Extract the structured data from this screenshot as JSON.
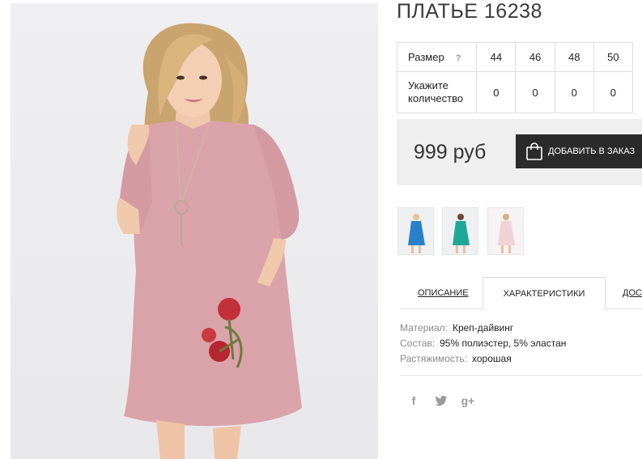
{
  "product": {
    "title": "ПЛАТЬЕ 16238",
    "main_image_alt": "pink dress model photo"
  },
  "sizes": {
    "size_label": "Размер",
    "help_label": "?",
    "qty_label_line1": "Укажите",
    "qty_label_line2": "количество",
    "values": [
      "44",
      "46",
      "48",
      "50"
    ],
    "quantities": [
      "0",
      "0",
      "0",
      "0"
    ]
  },
  "purchase": {
    "price": "999 руб",
    "add_to_cart_label": "ДОБАВИТЬ В ЗАКАЗ",
    "bag_icon": "shopping-bag-icon"
  },
  "thumbnails": [
    {
      "color": "#2a7fc9",
      "name": "blue"
    },
    {
      "color": "#1fa898",
      "name": "teal"
    },
    {
      "color": "#f0d2d6",
      "name": "pink"
    }
  ],
  "tabs": [
    {
      "label": "ОПИСАНИЕ"
    },
    {
      "label": "ХАРАКТЕРИСТИКИ"
    },
    {
      "label": "ДОСТАВКА"
    }
  ],
  "characteristics": [
    {
      "key": "Материал:",
      "value": "Креп-дайвинг"
    },
    {
      "key": "Состав:",
      "value": "95% полиэстер, 5% эластан"
    },
    {
      "key": "Растяжимость:",
      "value": "хорошая"
    }
  ],
  "social": {
    "facebook": "f",
    "twitter": "twitter-icon",
    "googleplus": "g+"
  },
  "colors": {
    "dress": "#d9a3a9",
    "button_bg": "#2b2b2b",
    "price_bg": "#efefef"
  }
}
